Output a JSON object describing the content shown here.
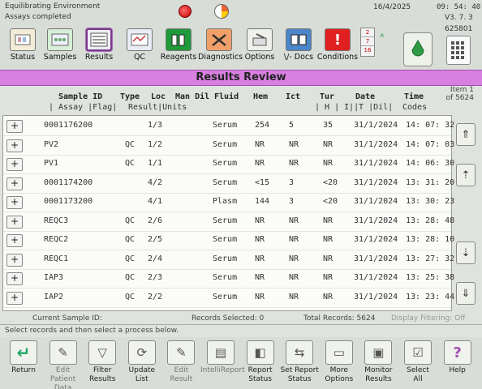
{
  "status": {
    "line1": "Equilibrating Environment",
    "line2": "Assays completed"
  },
  "datetime": {
    "date": "16/4/2025",
    "time": "09: 54: 40"
  },
  "system": {
    "version": "V3. 7. 3",
    "serial": "625801"
  },
  "tray_numbers": [
    "2",
    "7",
    "16"
  ],
  "toolbar": [
    {
      "id": "status",
      "label": "Status",
      "icon": "status-icon"
    },
    {
      "id": "samples",
      "label": "Samples",
      "icon": "samples-icon"
    },
    {
      "id": "results",
      "label": "Results",
      "icon": "results-icon"
    },
    {
      "id": "qc",
      "label": "QC",
      "icon": "qc-icon"
    },
    {
      "id": "reagents",
      "label": "Reagents",
      "icon": "reagents-icon"
    },
    {
      "id": "diagnostics",
      "label": "Diagnostics",
      "icon": "tools-icon"
    },
    {
      "id": "options",
      "label": "Options",
      "icon": "options-icon"
    },
    {
      "id": "docs",
      "label": "\\/- Docs",
      "icon": "docs-icon"
    },
    {
      "id": "conditions",
      "label": "Conditions",
      "icon": "alert-icon"
    }
  ],
  "page_title": "Results Review",
  "item_label": "Item 1",
  "item_count": "of 5624",
  "headers": {
    "sample_id": "Sample ID",
    "type": "Type",
    "loc": "Loc",
    "man_dil": "Man Dil",
    "fluid": "Fluid",
    "hem": "Hem",
    "ict": "Ict",
    "tur": "Tur",
    "date": "Date",
    "time": "Time",
    "assay_flag": "| Assay |Flag|",
    "result_units": "Result|Units",
    "h_i": "| H |  I |",
    "t_dil": "| T |Dil|",
    "codes": "Codes"
  },
  "rows": [
    {
      "id": "0001176200",
      "type": "",
      "loc": "1/3",
      "fluid": "Serum",
      "hem": "254",
      "ict": "5",
      "tur": "35",
      "date": "31/1/2024",
      "time": "14: 07: 32"
    },
    {
      "id": "PV2",
      "type": "QC",
      "loc": "1/2",
      "fluid": "Serum",
      "hem": "NR",
      "ict": "NR",
      "tur": "NR",
      "date": "31/1/2024",
      "time": "14: 07: 03"
    },
    {
      "id": "PV1",
      "type": "QC",
      "loc": "1/1",
      "fluid": "Serum",
      "hem": "NR",
      "ict": "NR",
      "tur": "NR",
      "date": "31/1/2024",
      "time": "14: 06: 30"
    },
    {
      "id": "0001174200",
      "type": "",
      "loc": "4/2",
      "fluid": "Serum",
      "hem": "<15",
      "ict": "3",
      "tur": "<20",
      "date": "31/1/2024",
      "time": "13: 31: 20"
    },
    {
      "id": "0001173200",
      "type": "",
      "loc": "4/1",
      "fluid": "Plasm",
      "hem": "144",
      "ict": "3",
      "tur": "<20",
      "date": "31/1/2024",
      "time": "13: 30: 23"
    },
    {
      "id": "REQC3",
      "type": "QC",
      "loc": "2/6",
      "fluid": "Serum",
      "hem": "NR",
      "ict": "NR",
      "tur": "NR",
      "date": "31/1/2024",
      "time": "13: 28: 48"
    },
    {
      "id": "REQC2",
      "type": "QC",
      "loc": "2/5",
      "fluid": "Serum",
      "hem": "NR",
      "ict": "NR",
      "tur": "NR",
      "date": "31/1/2024",
      "time": "13: 28: 10"
    },
    {
      "id": "REQC1",
      "type": "QC",
      "loc": "2/4",
      "fluid": "Serum",
      "hem": "NR",
      "ict": "NR",
      "tur": "NR",
      "date": "31/1/2024",
      "time": "13: 27: 32"
    },
    {
      "id": "IAP3",
      "type": "QC",
      "loc": "2/3",
      "fluid": "Serum",
      "hem": "NR",
      "ict": "NR",
      "tur": "NR",
      "date": "31/1/2024",
      "time": "13: 25: 38"
    },
    {
      "id": "IAP2",
      "type": "QC",
      "loc": "2/2",
      "fluid": "Serum",
      "hem": "NR",
      "ict": "NR",
      "tur": "NR",
      "date": "31/1/2024",
      "time": "13: 23: 44"
    }
  ],
  "footer": {
    "current_sample": "Current Sample ID:",
    "records_selected": "Records Selected:  0",
    "total_records": "Total Records:  5624",
    "display_filtering": "Display Filtering: Off",
    "hint": "Select records and then select a process below."
  },
  "bottom_buttons": [
    {
      "id": "return",
      "line1": "Return",
      "line2": "",
      "icon": "return-arrow-icon"
    },
    {
      "id": "edit-patient",
      "line1": "Edit Patient",
      "line2": "Data",
      "icon": "edit-patient-icon"
    },
    {
      "id": "filter",
      "line1": "Filter",
      "line2": "Results",
      "icon": "filter-icon"
    },
    {
      "id": "update",
      "line1": "Update",
      "line2": "List",
      "icon": "update-list-icon"
    },
    {
      "id": "edit-result",
      "line1": "Edit",
      "line2": "Result",
      "icon": "edit-result-icon"
    },
    {
      "id": "intellireport",
      "line1": "IntelliReport",
      "line2": "",
      "icon": "intellireport-icon"
    },
    {
      "id": "report-status",
      "line1": "Report",
      "line2": "Status",
      "icon": "report-status-icon"
    },
    {
      "id": "set-report-status",
      "line1": "Set Report",
      "line2": "Status",
      "icon": "set-report-icon"
    },
    {
      "id": "more-options",
      "line1": "More",
      "line2": "Options",
      "icon": "more-options-icon"
    },
    {
      "id": "monitor",
      "line1": "Monitor",
      "line2": "Results",
      "icon": "monitor-icon"
    },
    {
      "id": "select-all",
      "line1": "Select",
      "line2": "All",
      "icon": "select-all-icon"
    },
    {
      "id": "help",
      "line1": "Help",
      "line2": "",
      "icon": "help-icon"
    }
  ],
  "colors": {
    "title_bar": "#d780e0",
    "alert_red": "#d00000",
    "active_border": "#7a3a8a"
  }
}
